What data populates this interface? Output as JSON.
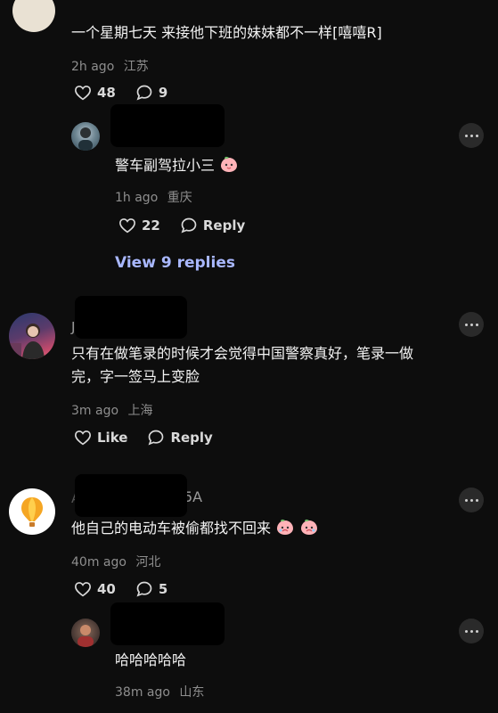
{
  "comments": [
    {
      "text": "一个星期七天 来接他下班的妹妹都不一样[嘻嘻R]",
      "time": "2h ago",
      "location": "江苏",
      "likes": "48",
      "replies_count": "9"
    },
    {
      "text": "警车副驾拉小三",
      "time": "1h ago",
      "location": "重庆",
      "likes": "22",
      "reply_label": "Reply",
      "view_replies": "View 9 replies"
    },
    {
      "username_partial": "J",
      "text_line1": "只有在做笔录的时候才会觉得中国警察真好，笔录一做",
      "text_line2": "完，字一签马上变脸",
      "time": "3m ago",
      "location": "上海",
      "like_label": "Like",
      "reply_label": "Reply"
    },
    {
      "username_partial_start": "A",
      "username_partial_end": "5A",
      "text": "他自己的电动车被偷都找不回来",
      "time": "40m ago",
      "location": "河北",
      "likes": "40",
      "replies_count": "5"
    },
    {
      "text": "哈哈哈哈哈",
      "time": "38m ago",
      "location": "山东"
    }
  ],
  "colors": {
    "background": "#0d0d0d",
    "text": "#f3f3f3",
    "meta": "#8e8e8e",
    "link": "#a9b8ff"
  },
  "icons": [
    "heart-icon",
    "comment-bubble-icon",
    "more-dots-icon",
    "peach-emoji"
  ]
}
